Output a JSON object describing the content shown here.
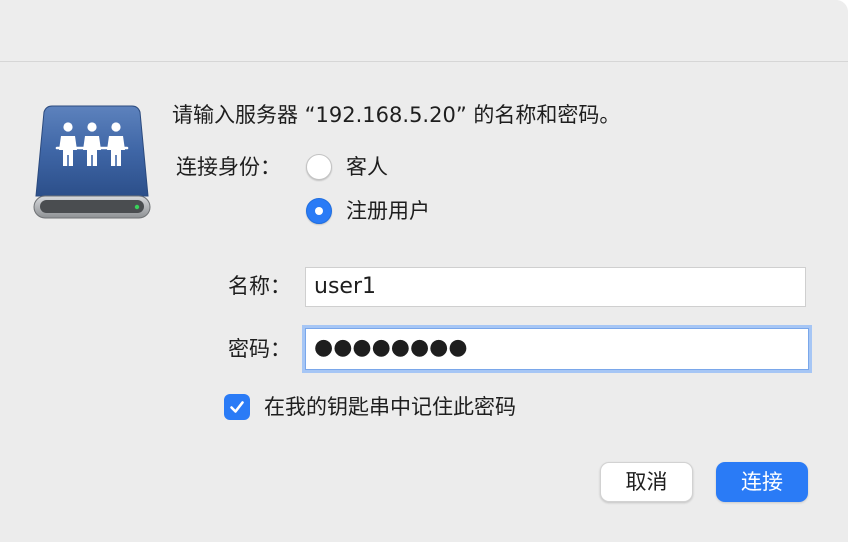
{
  "dialog": {
    "prompt": "请输入服务器 “192.168.5.20” 的名称和密码。",
    "connect_as": {
      "label": "连接身份：",
      "options": [
        {
          "label": "客人",
          "selected": false
        },
        {
          "label": "注册用户",
          "selected": true
        }
      ]
    },
    "name_field": {
      "label": "名称：",
      "value": "user1"
    },
    "password_field": {
      "label": "密码：",
      "value": "●●●●●●●●"
    },
    "remember_checkbox": {
      "label": "在我的钥匙串中记住此密码",
      "checked": true
    },
    "buttons": {
      "cancel": "取消",
      "connect": "连接"
    }
  },
  "colors": {
    "accent": "#2a7bf6",
    "window_bg": "#ececec",
    "icon_blue": "#3f66a6"
  },
  "icons": {
    "server": "shared-drive-icon",
    "checkmark": "checkmark-icon"
  }
}
